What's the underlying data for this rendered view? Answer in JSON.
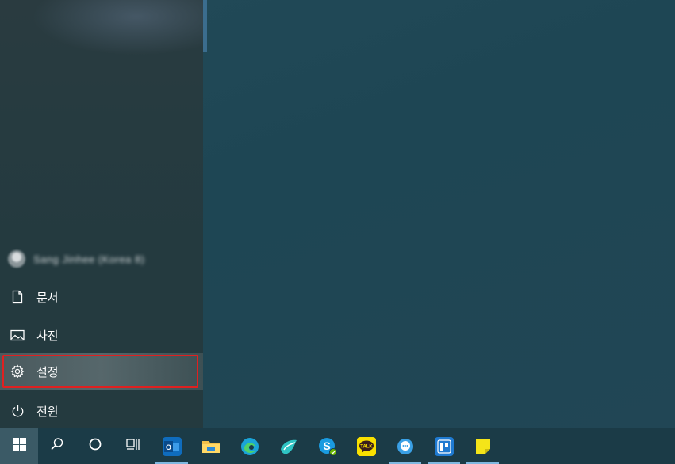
{
  "start_menu": {
    "user": {
      "name": "Sang Jinhee (Korea 8)"
    },
    "items": [
      {
        "label": "문서",
        "icon": "document-icon"
      },
      {
        "label": "사진",
        "icon": "photo-icon"
      },
      {
        "label": "설정",
        "icon": "gear-icon"
      },
      {
        "label": "전원",
        "icon": "power-icon"
      }
    ]
  },
  "taskbar": {
    "start_icon": "windows-logo-icon",
    "search_icon": "search-icon",
    "cortana_icon": "cortana-circle-icon",
    "taskview_icon": "task-view-icon",
    "apps": [
      {
        "name": "Outlook",
        "icon": "outlook-icon",
        "color": "#0f6cbd"
      },
      {
        "name": "File Explorer",
        "icon": "folder-icon",
        "color": "#f2c04a"
      },
      {
        "name": "Microsoft Edge",
        "icon": "edge-icon",
        "color": "#1aa4d8"
      },
      {
        "name": "Bird app",
        "icon": "bird-icon",
        "color": "#2fc4c4"
      },
      {
        "name": "Skype",
        "icon": "skype-icon",
        "color": "#1a9be0"
      },
      {
        "name": "KakaoTalk",
        "icon": "kakaotalk-icon",
        "color": "#f9e000",
        "badge_text": "TALK"
      },
      {
        "name": "Messenger",
        "icon": "chat-bubble-icon",
        "color": "#3aa0e6"
      },
      {
        "name": "Trello",
        "icon": "trello-icon",
        "color": "#1f7ad1"
      },
      {
        "name": "Sticky Notes",
        "icon": "sticky-notes-icon",
        "color": "#f4e419"
      }
    ]
  },
  "colors": {
    "desktop_bg": "#1f4553",
    "start_menu_bg": "#263b40",
    "taskbar_bg": "#1b3b47",
    "highlight_border": "#e02020",
    "active_underline": "#7fb8e0"
  }
}
